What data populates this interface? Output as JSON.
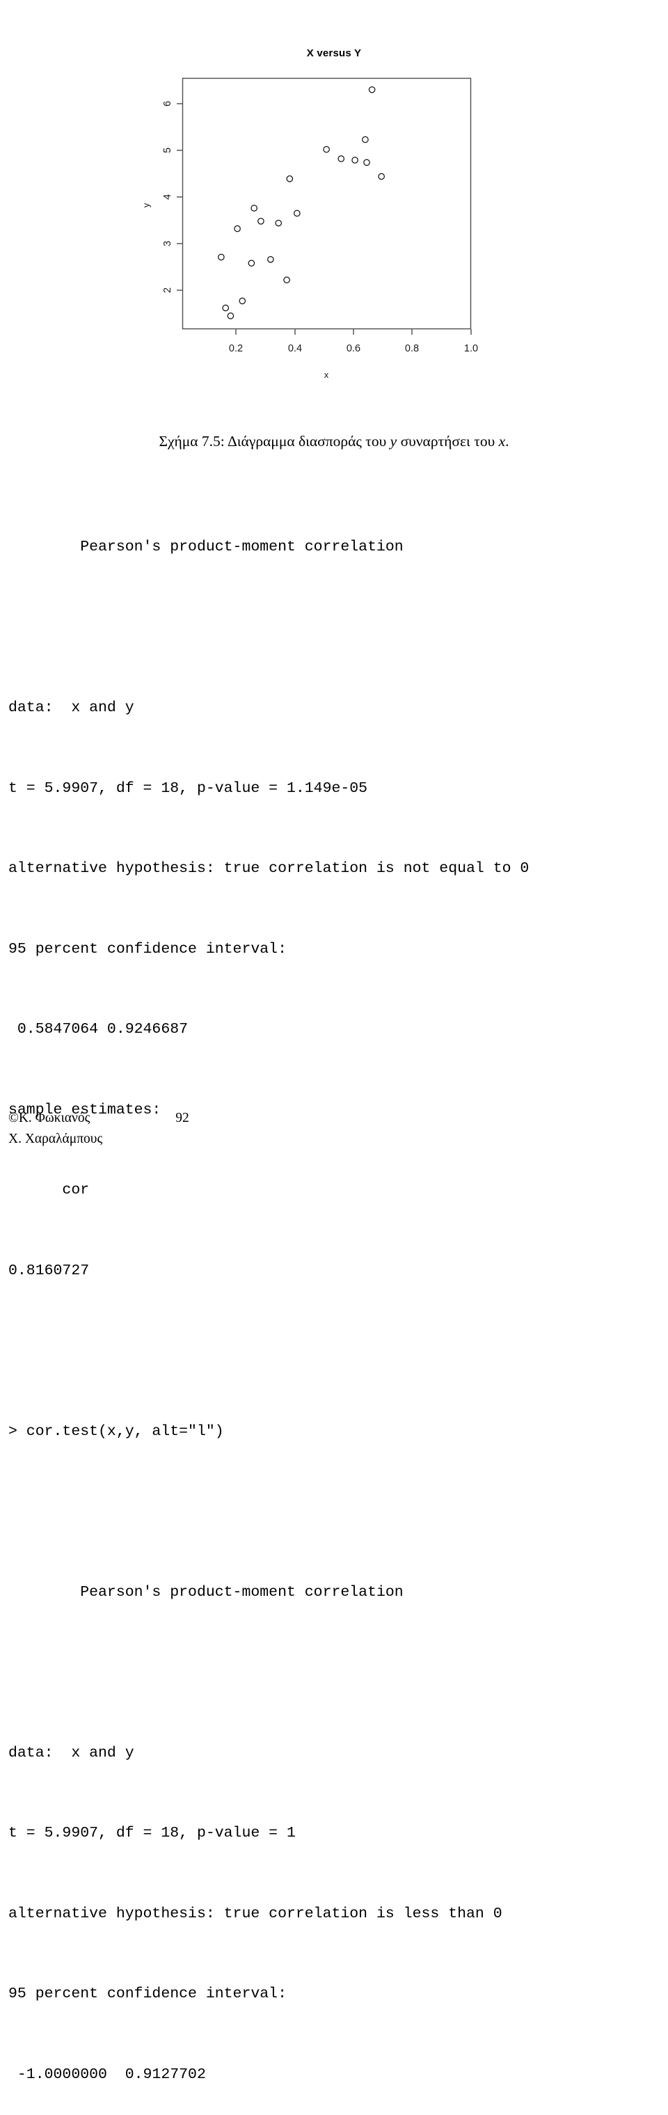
{
  "figure": {
    "title": "X versus Y",
    "xlabel": "x",
    "ylabel": "y",
    "x_ticks": [
      "0.2",
      "0.4",
      "0.6",
      "0.8",
      "1.0"
    ],
    "y_ticks": [
      "2",
      "3",
      "4",
      "5",
      "6"
    ]
  },
  "chart_data": {
    "type": "scatter",
    "title": "X versus Y",
    "xlabel": "x",
    "ylabel": "y",
    "xlim": [
      0.13,
      1.04
    ],
    "ylim": [
      1.45,
      6.45
    ],
    "xticks": [
      0.2,
      0.4,
      0.6,
      0.8,
      1.0
    ],
    "yticks": [
      2,
      3,
      4,
      5,
      6
    ],
    "grid": false,
    "legend": null,
    "marker": "open-circle",
    "n": 20,
    "points": [
      {
        "x": 0.15,
        "y": 2.71
      },
      {
        "x": 0.165,
        "y": 1.62
      },
      {
        "x": 0.182,
        "y": 1.45
      },
      {
        "x": 0.205,
        "y": 3.32
      },
      {
        "x": 0.222,
        "y": 1.77
      },
      {
        "x": 0.253,
        "y": 2.58
      },
      {
        "x": 0.262,
        "y": 3.76
      },
      {
        "x": 0.285,
        "y": 3.48
      },
      {
        "x": 0.318,
        "y": 2.66
      },
      {
        "x": 0.345,
        "y": 3.44
      },
      {
        "x": 0.373,
        "y": 2.22
      },
      {
        "x": 0.383,
        "y": 4.39
      },
      {
        "x": 0.408,
        "y": 3.65
      },
      {
        "x": 0.508,
        "y": 5.02
      },
      {
        "x": 0.558,
        "y": 4.82
      },
      {
        "x": 0.605,
        "y": 4.79
      },
      {
        "x": 0.64,
        "y": 5.23
      },
      {
        "x": 0.645,
        "y": 4.74
      },
      {
        "x": 0.663,
        "y": 6.3
      },
      {
        "x": 0.695,
        "y": 4.44
      }
    ]
  },
  "caption": {
    "prefix": "Σχήμα 7.5: Διάγραμμα διασποράς του ",
    "var1": "y",
    "middle": " συναρτήσει του ",
    "var2": "x",
    "suffix": "."
  },
  "console": {
    "block1": {
      "heading": "        Pearson's product-moment correlation",
      "data_line": "data:  x and y",
      "stat_line": "t = 5.9907, df = 18, p-value = 1.149e-05",
      "alternative": "alternative hypothesis: true correlation is not equal to 0",
      "ci_label": "95 percent confidence interval:",
      "ci_values": " 0.5847064 0.9246687",
      "estimates_label": "sample estimates:",
      "estimates_name": "      cor",
      "estimates_value": "0.8160727"
    },
    "command2": "> cor.test(x,y, alt=\"l\")",
    "block2": {
      "heading": "        Pearson's product-moment correlation",
      "data_line": "data:  x and y",
      "stat_line": "t = 5.9907, df = 18, p-value = 1",
      "alternative": "alternative hypothesis: true correlation is less than 0",
      "ci_label": "95 percent confidence interval:",
      "ci_values": " -1.0000000  0.9127702"
    }
  },
  "footer": {
    "author_line1": "©Κ. Φωκιανός",
    "author_line2": "Χ. Χαραλάμπους",
    "page_number": "92"
  }
}
